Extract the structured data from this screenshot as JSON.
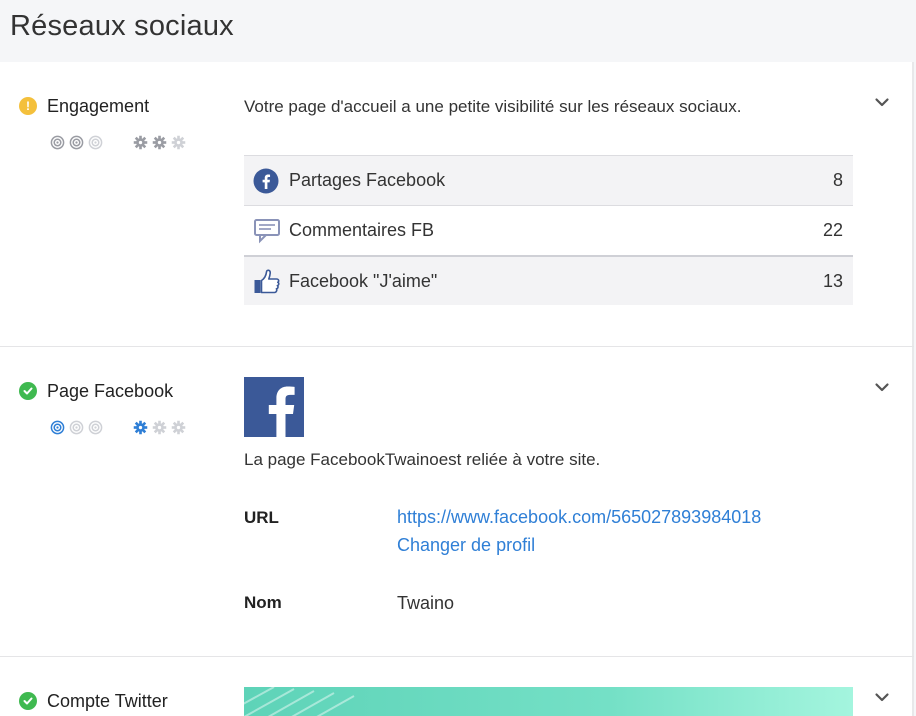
{
  "page": {
    "title": "Réseaux sociaux"
  },
  "colors": {
    "warn": "#f4c03c",
    "ok": "#3fb950",
    "link": "#2f7fd6",
    "facebook": "#3b5998"
  },
  "engagement": {
    "title": "Engagement",
    "status": "warning-icon",
    "description": "Votre page d'accueil a une petite visibilité sur les réseaux sociaux.",
    "metrics": [
      {
        "icon": "facebook-circle-icon",
        "label": "Partages Facebook",
        "value": "8"
      },
      {
        "icon": "comment-icon",
        "label": "Commentaires FB",
        "value": "22"
      },
      {
        "icon": "thumbs-up-icon",
        "label": "Facebook \"J'aime\"",
        "value": "13"
      }
    ]
  },
  "facebook_page": {
    "title": "Page Facebook",
    "status": "check-icon",
    "logo": "facebook-logo-icon",
    "description": "La page FacebookTwainoest reliée à votre site.",
    "url_label": "URL",
    "url_value": "https://www.facebook.com/565027893984018",
    "change_profile": "Changer de profil",
    "name_label": "Nom",
    "name_value": "Twaino"
  },
  "twitter": {
    "title": "Compte Twitter",
    "status": "check-icon"
  }
}
